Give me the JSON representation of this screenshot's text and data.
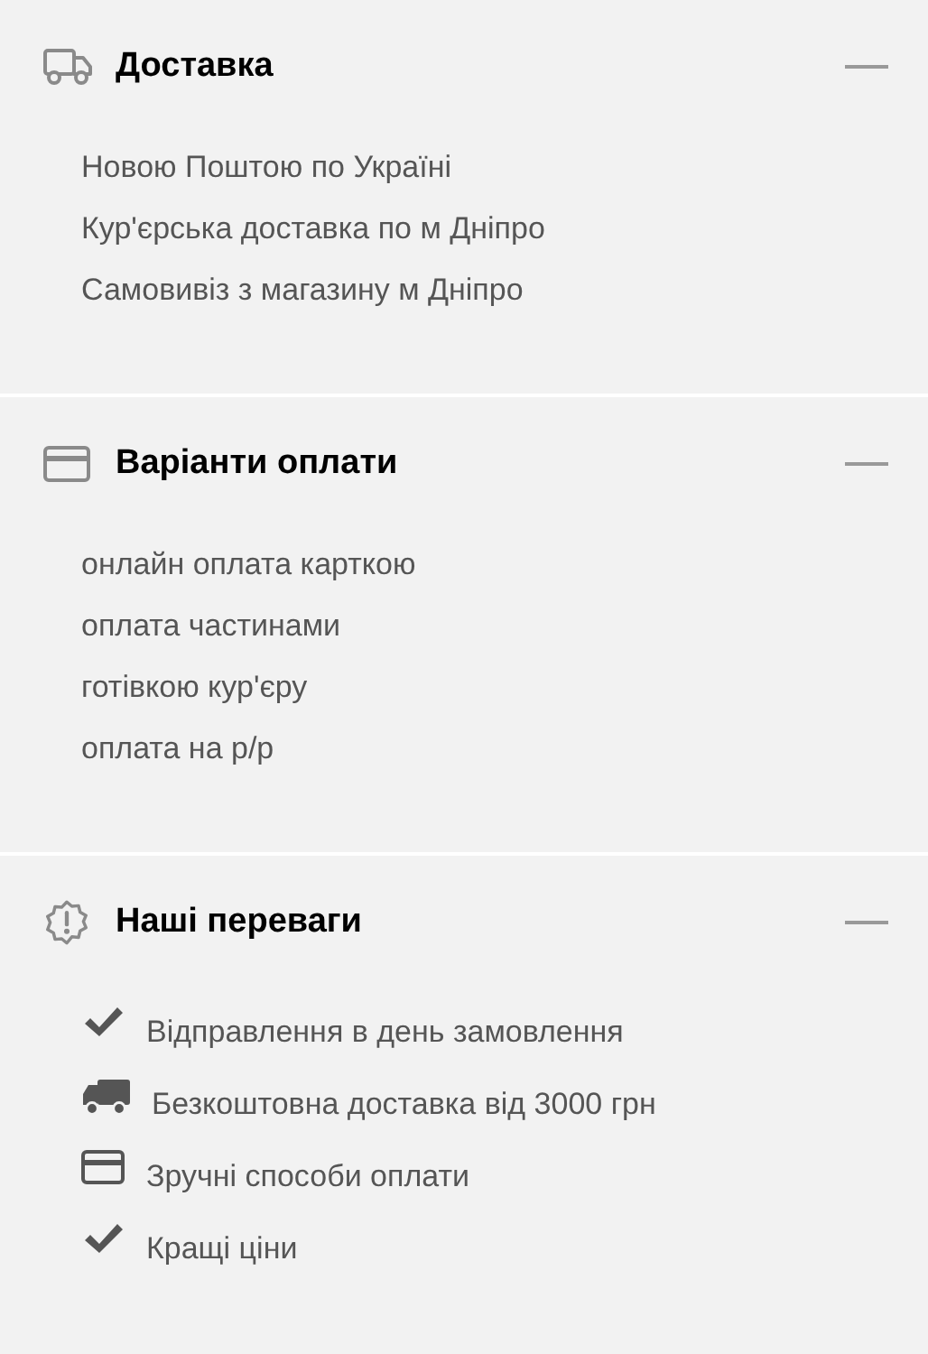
{
  "sections": [
    {
      "kind": "delivery",
      "title": "Доставка",
      "expanded": true,
      "items": [
        {
          "kind": "plain",
          "label": "Новою Поштою по Україні"
        },
        {
          "kind": "plain",
          "label": "Кур'єрська доставка по м Дніпро"
        },
        {
          "kind": "plain",
          "label": "Самовивіз з магазину м Дніпро"
        }
      ]
    },
    {
      "kind": "payment",
      "title": "Варіанти оплати",
      "expanded": true,
      "items": [
        {
          "kind": "plain",
          "label": "онлайн оплата карткою"
        },
        {
          "kind": "plain",
          "label": "оплата частинами"
        },
        {
          "kind": "plain",
          "label": "готівкою кур'єру"
        },
        {
          "kind": "plain",
          "label": "оплата на р/р"
        }
      ]
    },
    {
      "kind": "benefits",
      "title": "Наші переваги",
      "expanded": true,
      "items": [
        {
          "kind": "check",
          "label": "Відправлення в день замовлення"
        },
        {
          "kind": "truck",
          "label": "Безкоштовна доставка від 3000 грн"
        },
        {
          "kind": "card",
          "label": "Зручні способи оплати"
        },
        {
          "kind": "check",
          "label": "Кращі ціни"
        }
      ]
    }
  ]
}
